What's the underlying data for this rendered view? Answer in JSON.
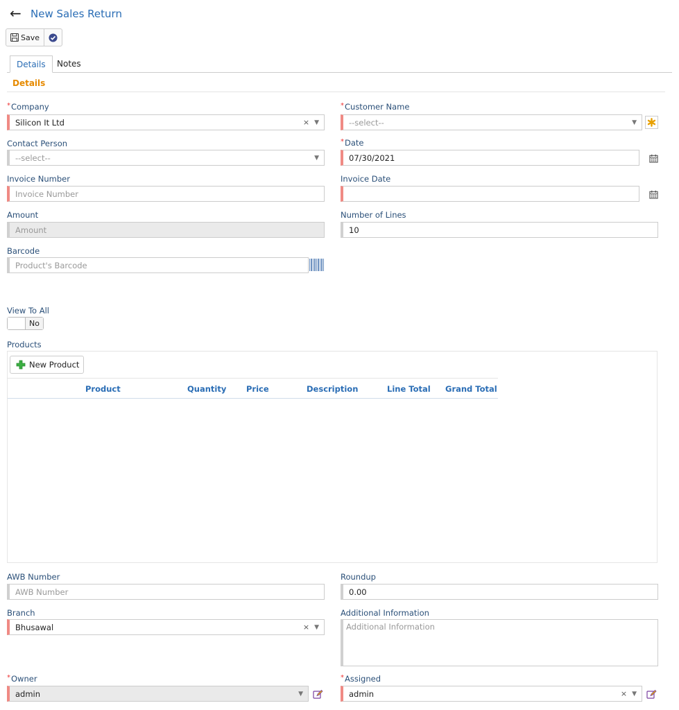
{
  "header": {
    "title": "New Sales Return"
  },
  "toolbar": {
    "save_label": "Save"
  },
  "tabs": [
    {
      "label": "Details"
    },
    {
      "label": "Notes"
    }
  ],
  "section": {
    "title": "Details"
  },
  "fields": {
    "company": {
      "label": "Company",
      "value": "Silicon It Ltd"
    },
    "customer_name": {
      "label": "Customer Name",
      "placeholder": "--select--"
    },
    "contact_person": {
      "label": "Contact Person",
      "placeholder": "--select--"
    },
    "date": {
      "label": "Date",
      "value": "07/30/2021"
    },
    "invoice_number": {
      "label": "Invoice Number",
      "placeholder": "Invoice Number"
    },
    "invoice_date": {
      "label": "Invoice Date",
      "value": ""
    },
    "amount": {
      "label": "Amount",
      "placeholder": "Amount"
    },
    "number_of_lines": {
      "label": "Number of Lines",
      "value": "10"
    },
    "barcode": {
      "label": "Barcode",
      "placeholder": "Product's Barcode"
    },
    "view_to_all": {
      "label": "View To All",
      "value": "No"
    },
    "awb_number": {
      "label": "AWB Number",
      "placeholder": "AWB Number"
    },
    "roundup": {
      "label": "Roundup",
      "value": "0.00"
    },
    "branch": {
      "label": "Branch",
      "value": "Bhusawal"
    },
    "additional_information": {
      "label": "Additional Information",
      "placeholder": "Additional Information"
    },
    "owner": {
      "label": "Owner",
      "value": "admin"
    },
    "assigned": {
      "label": "Assigned",
      "value": "admin"
    }
  },
  "products": {
    "label": "Products",
    "new_button": "New Product",
    "columns": [
      "Product",
      "Quantity",
      "Price",
      "Description",
      "Line Total",
      "Grand Total"
    ]
  },
  "colors": {
    "accent": "#2a6db5",
    "section": "#e68a00",
    "required": "#f08a84",
    "add": "#3cb043",
    "edit": "#7a3fa0"
  },
  "icons": [
    "back-arrow-icon",
    "save-icon",
    "check-circle-icon",
    "asterisk-icon",
    "calendar-icon",
    "barcode-icon",
    "plus-icon",
    "edit-icon"
  ]
}
